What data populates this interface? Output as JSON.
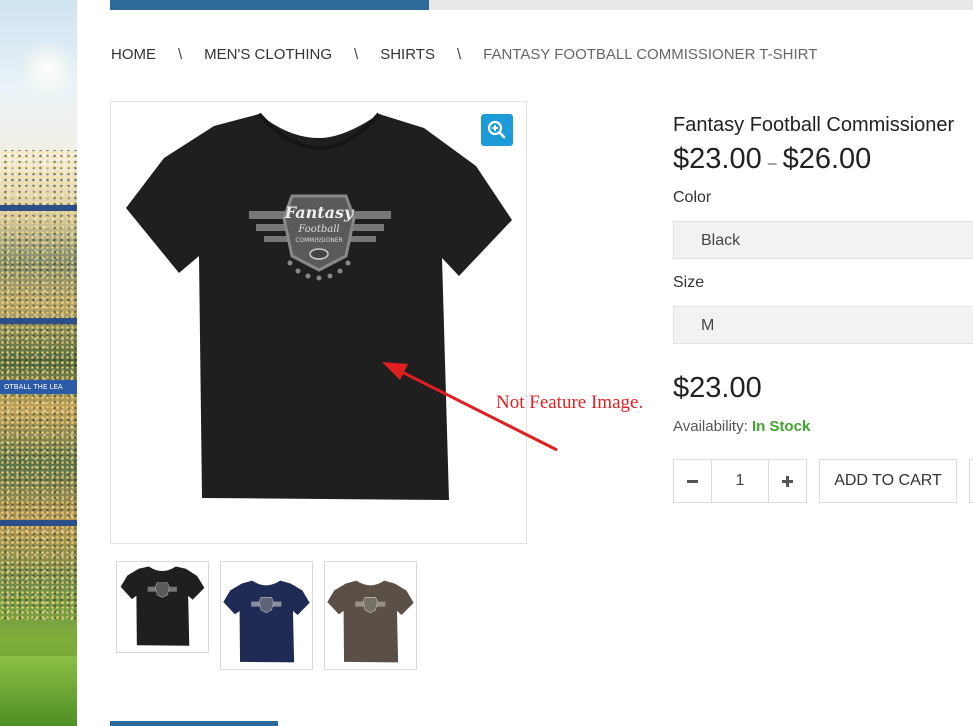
{
  "progress": {
    "value": 0.37
  },
  "breadcrumb": {
    "items": [
      "HOME",
      "MEN'S CLOTHING",
      "SHIRTS"
    ],
    "separator": "\\",
    "current": "FANTASY FOOTBALL COMMISSIONER T-SHIRT"
  },
  "background": {
    "banner_text": "OTBALL  THE LEA"
  },
  "gallery": {
    "main_image": {
      "shirt_color": "#1f1f1f",
      "logo_lines": [
        "Fantasy",
        "Football",
        "COMMISSIONER"
      ]
    },
    "zoom_icon": "zoom-in-icon",
    "thumbnails": [
      {
        "color": "#1f1f1f"
      },
      {
        "color": "#1f2a55"
      },
      {
        "color": "#5a5048"
      }
    ]
  },
  "annotation": {
    "text": "Not Feature Image.",
    "color": "#e02020"
  },
  "product": {
    "title": "Fantasy Football Commissioner",
    "price_from": "$23.00",
    "price_dash": "–",
    "price_to": "$26.00",
    "color_label": "Color",
    "color_value": "Black",
    "size_label": "Size",
    "size_value": "M",
    "price": "$23.00",
    "availability_label": "Availability:",
    "availability_value": "In Stock",
    "quantity": "1",
    "add_to_cart": "ADD TO CART"
  },
  "colors": {
    "accent": "#1d9bd6",
    "progress": "#2f6b9a",
    "in_stock": "#3ea52e"
  }
}
